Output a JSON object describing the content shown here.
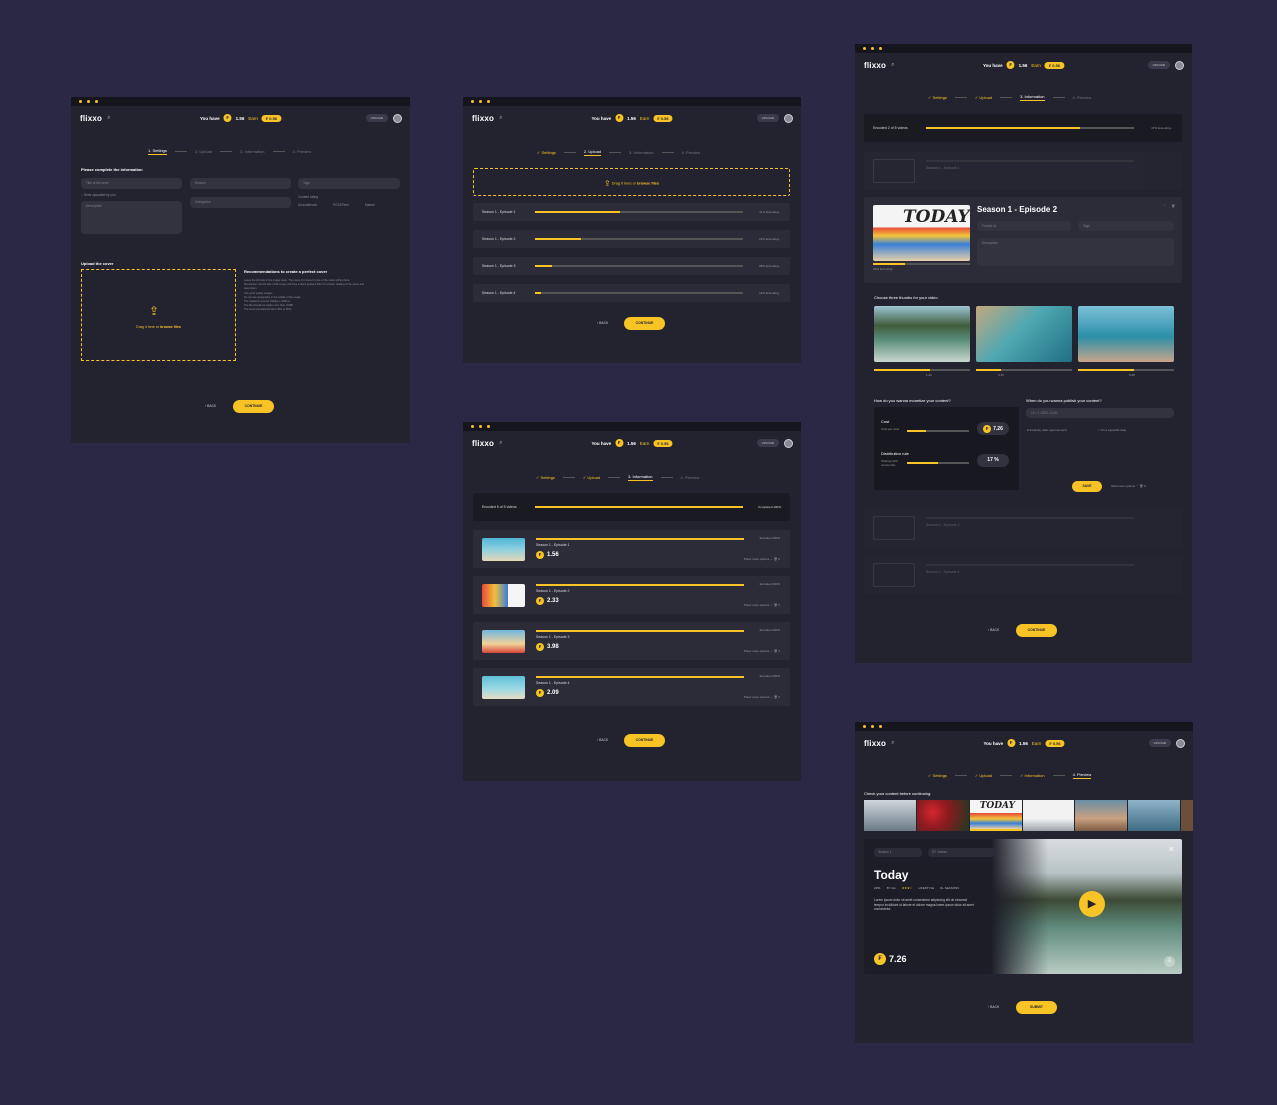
{
  "brand": {
    "logo": "flixxo",
    "accent": "#f7c325",
    "bg": "#2a2845",
    "panel": "#23232f"
  },
  "header": {
    "you_have": "You have",
    "balance": "1.56",
    "earn": "Earn",
    "earn_amount": "₣ 0.56",
    "upload": "UPLOAD",
    "search_icon": "search-icon"
  },
  "steps": {
    "s1": "1. Settings",
    "s2": "2. Upload",
    "s3": "3. Information",
    "s4": "4. Preview",
    "done1": "Settings",
    "done2": "Upload",
    "done3": "Information"
  },
  "nav": {
    "back": "BACK",
    "continue": "CONTINUE",
    "submit": "SUBMIT"
  },
  "settings": {
    "heading": "Please complete the information",
    "title_placeholder": "Title of the serie",
    "season_placeholder": "Season",
    "tags_placeholder": "Tags",
    "categories_placeholder": "Categories",
    "checkbox": "Serie uploaded by you",
    "description_placeholder": "Description",
    "rating_label": "Content rating",
    "rating_options": [
      "All audiences",
      "PG13/Teen",
      "Mature"
    ],
    "cover_title": "Upload the cover",
    "drop_text": "Drag it here or ",
    "drop_link": "browse files",
    "reco_title": "Recommendations to create a perfect cover",
    "reco_items": [
      "Leave the left side of the image clean. The name of it doesn't more of the video will be there.",
      "Remember: the left side of the image will have a black gradient filter for a better reading of the name and description.",
      "Use good quality images",
      "Do not use typography in the middle of the image",
      "The measure must be 1920px x 1080 px",
      "The file should not weigh more than 10MB",
      "The recommended format is JPG or PNG"
    ]
  },
  "upload": {
    "drop_text": "Drag it here or ",
    "drop_link": "browse files",
    "rows": [
      {
        "name": "Season 1 - Episode 1",
        "status": "41% Encoding...",
        "progress": 0.41
      },
      {
        "name": "Season 1 - Episode 2",
        "status": "22% Encoding...",
        "progress": 0.22
      },
      {
        "name": "Season 1 - Episode 3",
        "status": "08% Encoding...",
        "progress": 0.08
      },
      {
        "name": "Season 1 - Episode 4",
        "status": "12% Encoding...",
        "progress": 0.03
      }
    ]
  },
  "info_list": {
    "summary": "Encoded 5 of 5 videos",
    "summary_status": "Completed 100%",
    "show_more": "Show more options",
    "rows": [
      {
        "name": "Season 1 - Episode 1",
        "status": "Encoded 100%",
        "price": "1.56"
      },
      {
        "name": "Season 1 - Episode 2",
        "status": "Encoded 100%",
        "price": "2.33"
      },
      {
        "name": "Season 1 - Episode 3",
        "status": "Encoded 100%",
        "price": "3.98"
      },
      {
        "name": "Season 1 - Episode 4",
        "status": "Encoded 100%",
        "price": "2.09"
      }
    ]
  },
  "info_detail": {
    "summary": "Encoded 2 of 5 videos",
    "summary_status": "47% Encoding...",
    "collapsed_label": "Season 1 - Episode 1",
    "episode_title": "Season 1 - Episode 2",
    "cover_text": "TODAY",
    "episode_status": "33% Encoding...",
    "format_placeholder": "Format #1",
    "tags_placeholder": "Tags",
    "description_placeholder": "Description",
    "thumbs_title": "Choose three thumbs for your video",
    "thumb_times": [
      "1:20",
      "3:15",
      "5:08"
    ],
    "monetize_title": "How do you wanna monetize your content?",
    "cost_label": "Cost",
    "cost_sub": "Cost per view",
    "cost_value": "7.26",
    "cost_level": 0.3,
    "dist_label": "Distribution rule",
    "dist_sub": "Sharing with community",
    "dist_value": "17 %",
    "dist_level": 0.5,
    "publish_title": "When do you wanna publish your content?",
    "publish_select": "12 / 1 / 2021 11:00",
    "publish_opt1": "Instantly, after approvement",
    "publish_opt2": "On a especific date",
    "save": "SAVE",
    "show_less": "Show less options",
    "collapsed_rows": [
      "Season 1 - Episode 3",
      "Season 1 - Episode 4"
    ]
  },
  "preview": {
    "check_text": "Check your content before continuing:",
    "season_select": "Season 1",
    "episode_select": "E2. Nature",
    "title": "Today",
    "meta": [
      "2451",
      "87 min",
      "★★★☆",
      "LIFESTYLE",
      "8+ SEASONS"
    ],
    "description": "Lorem ipsum dolor sit amet consectetur adipiscing elit do eiusmod tempor incididunt ut labore et dolore magna lorem ipsum dolor sit amet consectetur.",
    "price": "7.26",
    "strip_cover_text": "TODAY"
  }
}
